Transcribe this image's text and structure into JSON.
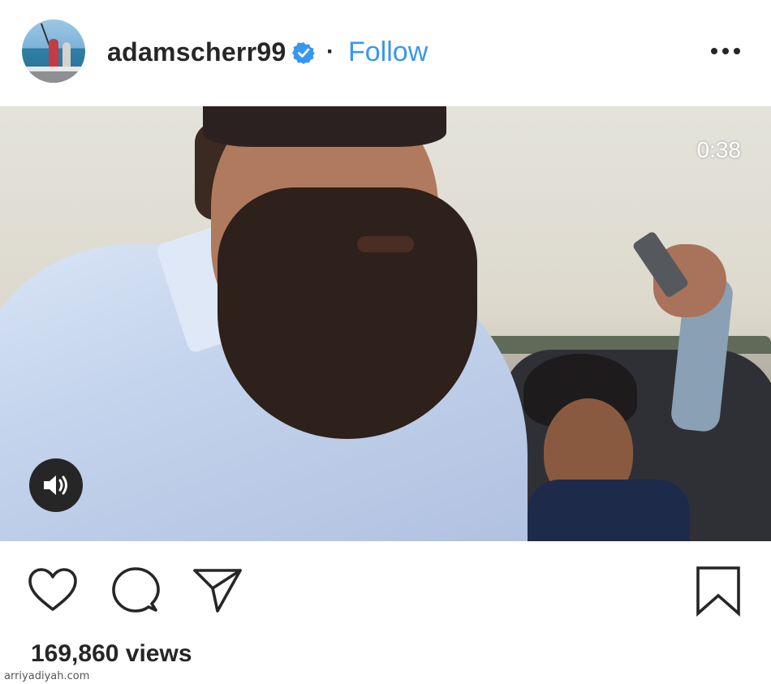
{
  "post": {
    "username": "adamscherr99",
    "separator": "·",
    "follow_label": "Follow",
    "verified_icon": "verified-badge-icon",
    "more_icon": "more-options-icon"
  },
  "video": {
    "duration": "0:38",
    "sound_icon": "speaker-icon"
  },
  "actions": {
    "like_icon": "heart-icon",
    "comment_icon": "comment-icon",
    "share_icon": "send-icon",
    "save_icon": "bookmark-icon"
  },
  "stats": {
    "views": "169,860 views"
  },
  "watermark": "arriyadiyah.com",
  "colors": {
    "link_blue": "#3897f0",
    "text": "#262626",
    "verified_blue": "#3897f0"
  }
}
